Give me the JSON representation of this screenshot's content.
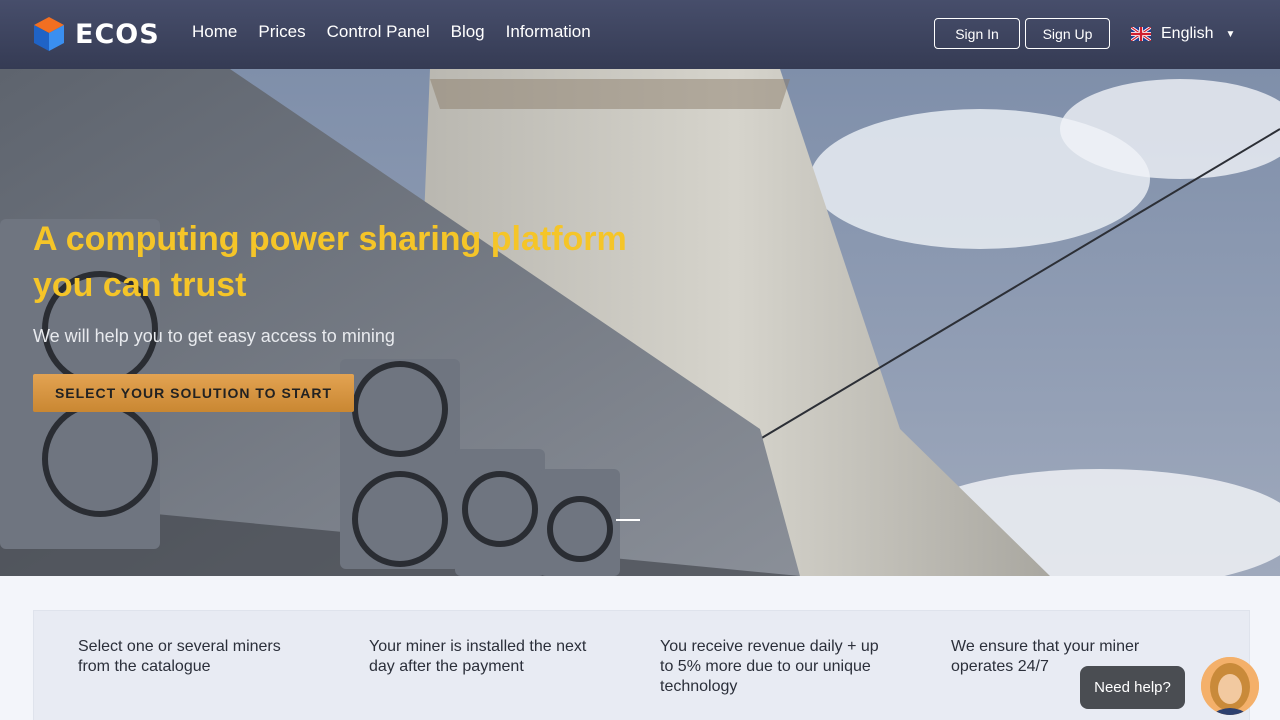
{
  "header": {
    "logo_text": "ECOS",
    "nav": [
      "Home",
      "Prices",
      "Control Panel",
      "Blog",
      "Information"
    ],
    "sign_in": "Sign In",
    "sign_up": "Sign Up",
    "language": "English"
  },
  "hero": {
    "title_line1": "A computing power sharing platform",
    "title_line2": "you can trust",
    "subtitle": "We will help you to get easy access to mining",
    "cta": "SELECT YOUR SOLUTION TO START"
  },
  "steps": [
    "Select one or several miners from the catalogue",
    "Your miner is installed the next day after the payment",
    "You receive revenue daily + up to 5% more due to our unique technology",
    "We ensure that your miner operates 24/7"
  ],
  "help": {
    "label": "Need help?"
  },
  "colors": {
    "accent_gold": "#f5c528",
    "cta": "#d9963f",
    "header": "#3d4360",
    "logo_orange": "#f26f21",
    "logo_blue": "#2d7fe0"
  }
}
